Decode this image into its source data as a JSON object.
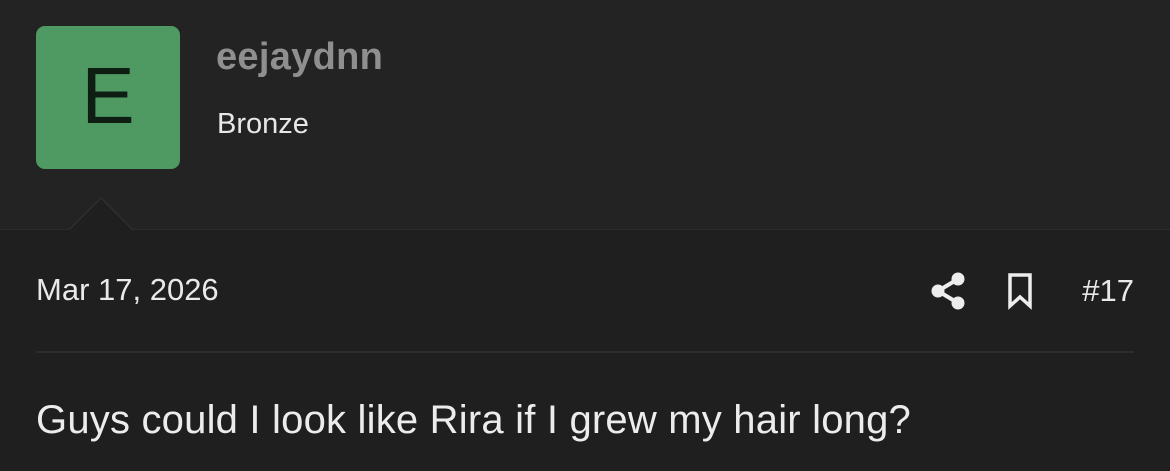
{
  "user": {
    "avatar_letter": "E",
    "avatar_color": "#4f9a63",
    "name": "eejaydnn",
    "title": "Bronze"
  },
  "post": {
    "date": "Mar 17, 2026",
    "number": "#17",
    "message": "Guys could I look like Rira if I grew my hair long?",
    "actions": {
      "share_icon": "share-icon",
      "bookmark_icon": "bookmark-icon"
    }
  }
}
